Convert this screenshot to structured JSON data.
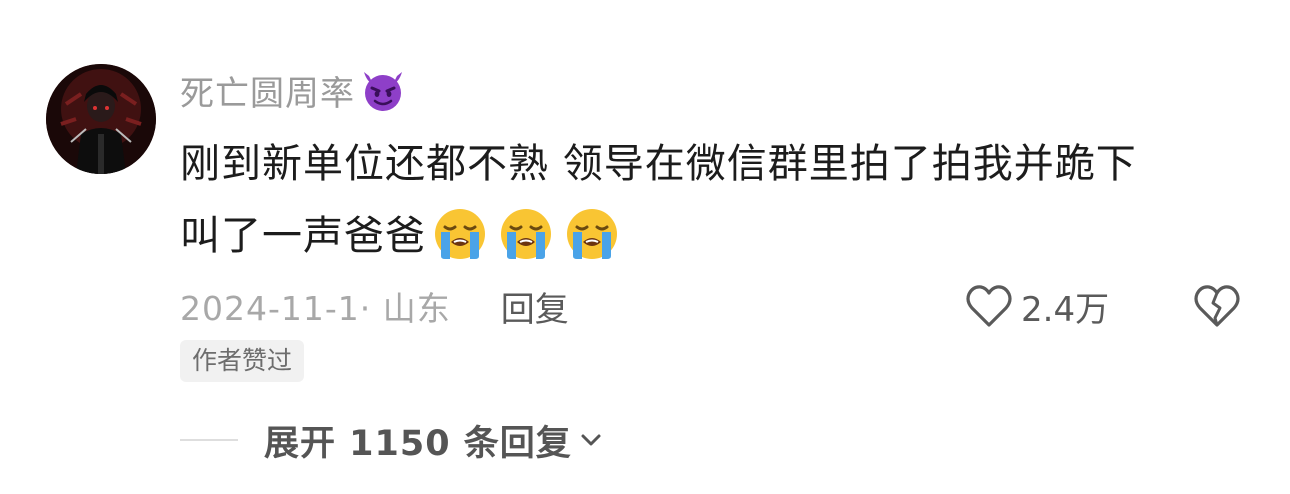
{
  "comment": {
    "username": "死亡圆周率",
    "username_badge_icon": "smiling-devil-emoji",
    "content_line1": "刚到新单位还都不熟 领导在微信群里拍了拍我并跪下",
    "content_line2": "叫了一声爸爸",
    "content_emojis": [
      "loudly-crying-face-emoji",
      "loudly-crying-face-emoji",
      "loudly-crying-face-emoji"
    ],
    "date_location": "2024-11-1· 山东",
    "reply_label": "回复",
    "like_icon": "heart-outline-icon",
    "like_count": "2.4万",
    "dislike_icon": "broken-heart-icon",
    "author_liked_tag": "作者赞过",
    "expand_replies_label": "展开 1150 条回复",
    "expand_icon": "chevron-down-icon"
  },
  "colors": {
    "username": "#9a9a9a",
    "content": "#1c1c1c",
    "meta": "#a8a8a8",
    "action": "#5a5a5a",
    "tag_bg": "#f1f1f1",
    "devil_purple": "#8e3fc8",
    "emoji_yellow": "#f9c533",
    "tear_blue": "#4aa3e8"
  }
}
